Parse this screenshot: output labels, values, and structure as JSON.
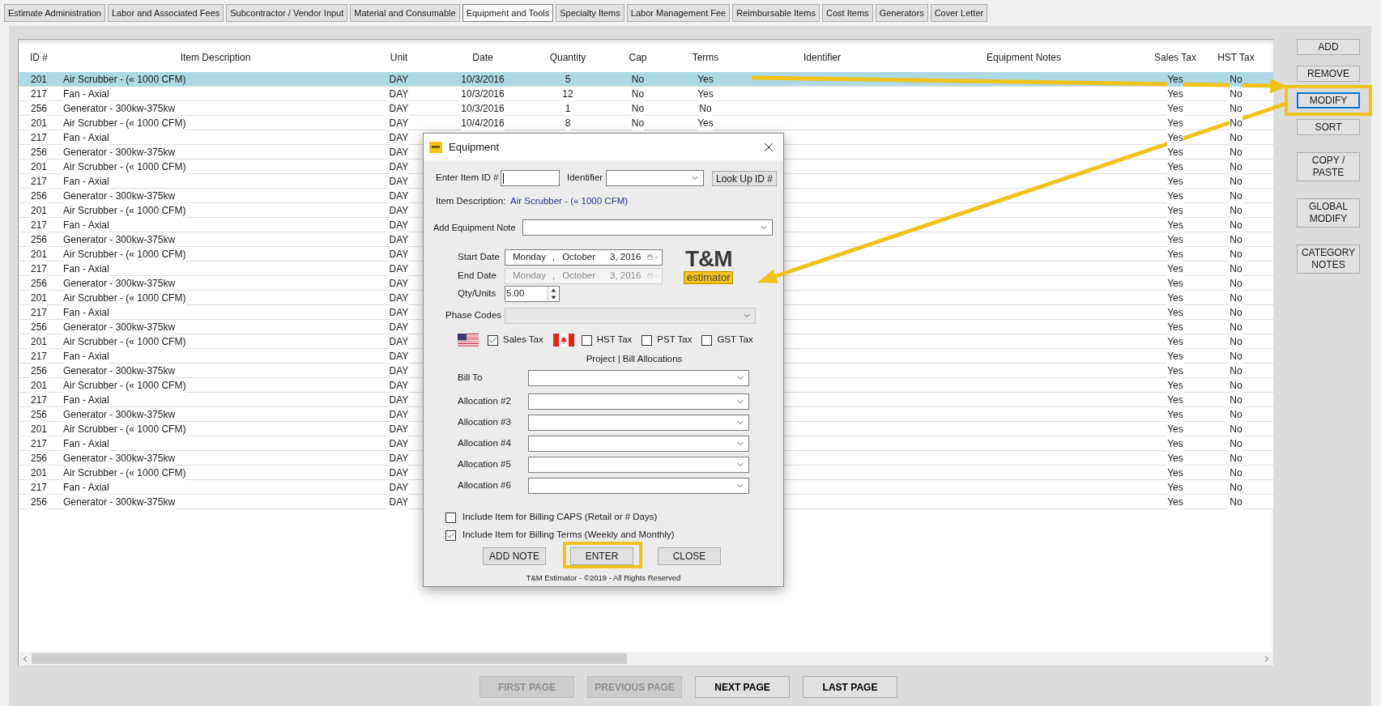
{
  "tabs": [
    {
      "label": "Estimate Administration",
      "selected": false
    },
    {
      "label": "Labor and Associated Fees",
      "selected": false
    },
    {
      "label": "Subcontractor / Vendor Input",
      "selected": false
    },
    {
      "label": "Material and Consumable",
      "selected": false
    },
    {
      "label": "Equipment and Tools",
      "selected": true
    },
    {
      "label": "Specialty Items",
      "selected": false
    },
    {
      "label": "Labor Management Fee",
      "selected": false
    },
    {
      "label": "Reimbursable Items",
      "selected": false
    },
    {
      "label": "Cost Items",
      "selected": false
    },
    {
      "label": "Generators",
      "selected": false
    },
    {
      "label": "Cover Letter",
      "selected": false
    }
  ],
  "table": {
    "columns": [
      "ID #",
      "Item Description",
      "Unit",
      "Date",
      "Quantity",
      "Cap",
      "Terms",
      "Identifier",
      "Equipment Notes",
      "Sales Tax",
      "HST Tax"
    ],
    "rows": [
      {
        "id": "201",
        "description": "Air Scrubber - (« 1000 CFM)",
        "unit": "DAY",
        "date": "10/3/2016",
        "quantity": "5",
        "cap": "No",
        "terms": "Yes",
        "sales_tax": "Yes",
        "hst_tax": "No",
        "selected": true
      },
      {
        "id": "217",
        "description": "Fan - Axial",
        "unit": "DAY",
        "date": "10/3/2016",
        "quantity": "12",
        "cap": "No",
        "terms": "Yes",
        "sales_tax": "Yes",
        "hst_tax": "No",
        "selected": false
      },
      {
        "id": "256",
        "description": "Generator - 300kw-375kw",
        "unit": "DAY",
        "date": "10/3/2016",
        "quantity": "1",
        "cap": "No",
        "terms": "No",
        "sales_tax": "Yes",
        "hst_tax": "No",
        "selected": false
      },
      {
        "id": "201",
        "description": "Air Scrubber - (« 1000 CFM)",
        "unit": "DAY",
        "date": "10/4/2016",
        "quantity": "8",
        "cap": "No",
        "terms": "Yes",
        "sales_tax": "Yes",
        "hst_tax": "No",
        "selected": false
      },
      {
        "id": "217",
        "description": "Fan - Axial",
        "unit": "DAY",
        "sales_tax": "Yes",
        "hst_tax": "No",
        "selected": false
      },
      {
        "id": "256",
        "description": "Generator - 300kw-375kw",
        "unit": "DAY",
        "sales_tax": "Yes",
        "hst_tax": "No",
        "selected": false
      },
      {
        "id": "201",
        "description": "Air Scrubber - (« 1000 CFM)",
        "unit": "DAY",
        "sales_tax": "Yes",
        "hst_tax": "No",
        "selected": false
      },
      {
        "id": "217",
        "description": "Fan - Axial",
        "unit": "DAY",
        "sales_tax": "Yes",
        "hst_tax": "No",
        "selected": false
      },
      {
        "id": "256",
        "description": "Generator - 300kw-375kw",
        "unit": "DAY",
        "sales_tax": "Yes",
        "hst_tax": "No",
        "selected": false
      },
      {
        "id": "201",
        "description": "Air Scrubber - (« 1000 CFM)",
        "unit": "DAY",
        "sales_tax": "Yes",
        "hst_tax": "No",
        "selected": false
      },
      {
        "id": "217",
        "description": "Fan - Axial",
        "unit": "DAY",
        "sales_tax": "Yes",
        "hst_tax": "No",
        "selected": false
      },
      {
        "id": "256",
        "description": "Generator - 300kw-375kw",
        "unit": "DAY",
        "sales_tax": "Yes",
        "hst_tax": "No",
        "selected": false
      },
      {
        "id": "201",
        "description": "Air Scrubber - (« 1000 CFM)",
        "unit": "DAY",
        "sales_tax": "Yes",
        "hst_tax": "No",
        "selected": false
      },
      {
        "id": "217",
        "description": "Fan - Axial",
        "unit": "DAY",
        "sales_tax": "Yes",
        "hst_tax": "No",
        "selected": false
      },
      {
        "id": "256",
        "description": "Generator - 300kw-375kw",
        "unit": "DAY",
        "sales_tax": "Yes",
        "hst_tax": "No",
        "selected": false
      },
      {
        "id": "201",
        "description": "Air Scrubber - (« 1000 CFM)",
        "unit": "DAY",
        "sales_tax": "Yes",
        "hst_tax": "No",
        "selected": false
      },
      {
        "id": "217",
        "description": "Fan - Axial",
        "unit": "DAY",
        "sales_tax": "Yes",
        "hst_tax": "No",
        "selected": false
      },
      {
        "id": "256",
        "description": "Generator - 300kw-375kw",
        "unit": "DAY",
        "sales_tax": "Yes",
        "hst_tax": "No",
        "selected": false
      },
      {
        "id": "201",
        "description": "Air Scrubber - (« 1000 CFM)",
        "unit": "DAY",
        "sales_tax": "Yes",
        "hst_tax": "No",
        "selected": false
      },
      {
        "id": "217",
        "description": "Fan - Axial",
        "unit": "DAY",
        "sales_tax": "Yes",
        "hst_tax": "No",
        "selected": false
      },
      {
        "id": "256",
        "description": "Generator - 300kw-375kw",
        "unit": "DAY",
        "sales_tax": "Yes",
        "hst_tax": "No",
        "selected": false
      },
      {
        "id": "201",
        "description": "Air Scrubber - (« 1000 CFM)",
        "unit": "DAY",
        "sales_tax": "Yes",
        "hst_tax": "No",
        "selected": false
      },
      {
        "id": "217",
        "description": "Fan - Axial",
        "unit": "DAY",
        "sales_tax": "Yes",
        "hst_tax": "No",
        "selected": false
      },
      {
        "id": "256",
        "description": "Generator - 300kw-375kw",
        "unit": "DAY",
        "sales_tax": "Yes",
        "hst_tax": "No",
        "selected": false
      },
      {
        "id": "201",
        "description": "Air Scrubber - (« 1000 CFM)",
        "unit": "DAY",
        "sales_tax": "Yes",
        "hst_tax": "No",
        "selected": false
      },
      {
        "id": "217",
        "description": "Fan - Axial",
        "unit": "DAY",
        "sales_tax": "Yes",
        "hst_tax": "No",
        "selected": false
      },
      {
        "id": "256",
        "description": "Generator - 300kw-375kw",
        "unit": "DAY",
        "sales_tax": "Yes",
        "hst_tax": "No",
        "selected": false
      },
      {
        "id": "201",
        "description": "Air Scrubber - (« 1000 CFM)",
        "unit": "DAY",
        "sales_tax": "Yes",
        "hst_tax": "No",
        "selected": false
      },
      {
        "id": "217",
        "description": "Fan - Axial",
        "unit": "DAY",
        "sales_tax": "Yes",
        "hst_tax": "No",
        "selected": false
      },
      {
        "id": "256",
        "description": "Generator - 300kw-375kw",
        "unit": "DAY",
        "sales_tax": "Yes",
        "hst_tax": "No",
        "selected": false
      }
    ]
  },
  "side_buttons": [
    {
      "label": "ADD",
      "focused": false,
      "highlighted": false
    },
    {
      "label": "REMOVE",
      "focused": false,
      "highlighted": false
    },
    {
      "label": "MODIFY",
      "focused": true,
      "highlighted": true
    },
    {
      "label": "SORT",
      "focused": false,
      "highlighted": false
    },
    {
      "label": "COPY / PASTE",
      "focused": false,
      "highlighted": false
    },
    {
      "label": "GLOBAL MODIFY",
      "focused": false,
      "highlighted": false
    },
    {
      "label": "CATEGORY NOTES",
      "focused": false,
      "highlighted": false
    }
  ],
  "pagination": [
    {
      "label": "FIRST PAGE",
      "disabled": true
    },
    {
      "label": "PREVIOUS PAGE",
      "disabled": true
    },
    {
      "label": "NEXT PAGE",
      "disabled": false
    },
    {
      "label": "LAST PAGE",
      "disabled": false
    }
  ],
  "dialog": {
    "title": "Equipment",
    "item_id": {
      "label": "Enter Item ID #"
    },
    "identifier": {
      "label": "Identifier"
    },
    "lookup_button": "Look Up ID #",
    "item_description": {
      "label": "Item Description:",
      "value": "Air Scrubber - (« 1000 CFM)"
    },
    "equipment_note": {
      "label": "Add Equipment Note"
    },
    "dates": [
      {
        "label": "Start Date",
        "parts": [
          "Monday",
          ",",
          "October",
          "3, 2016"
        ],
        "disabled": false
      },
      {
        "label": "End Date",
        "parts": [
          "Monday",
          ",",
          "October",
          "3, 2016"
        ],
        "disabled": true
      }
    ],
    "qty": {
      "label": "Qty/Units",
      "value": "5.00"
    },
    "logo": {
      "title": "T&M",
      "subtitle": "estimator"
    },
    "phase_codes": {
      "label": "Phase Codes",
      "disabled": true
    },
    "taxes": [
      {
        "label": "Sales Tax",
        "checked": true,
        "kind": "us"
      },
      {
        "label": "HST Tax",
        "checked": false,
        "kind": "ca"
      },
      {
        "label": "PST Tax",
        "checked": false,
        "kind": "plain"
      },
      {
        "label": "GST Tax",
        "checked": false,
        "kind": "plain"
      }
    ],
    "allocations_heading": "Project | Bill Allocations",
    "allocations": [
      {
        "label": "Bill To"
      },
      {
        "label": "Allocation #2"
      },
      {
        "label": "Allocation #3"
      },
      {
        "label": "Allocation #4"
      },
      {
        "label": "Allocation #5"
      },
      {
        "label": "Allocation #6"
      }
    ],
    "billing_options": [
      {
        "label": "Include Item for Billing CAPS (Retail or # Days)",
        "checked": false
      },
      {
        "label": "Include Item for Billing Terms (Weekly and Monthly)",
        "checked": true
      }
    ],
    "buttons": [
      {
        "label": "ADD NOTE",
        "highlighted": false
      },
      {
        "label": "ENTER",
        "highlighted": true
      },
      {
        "label": "CLOSE",
        "highlighted": false
      }
    ],
    "footer": "T&M Estimator - ©2019 - All Rights Reserved"
  }
}
